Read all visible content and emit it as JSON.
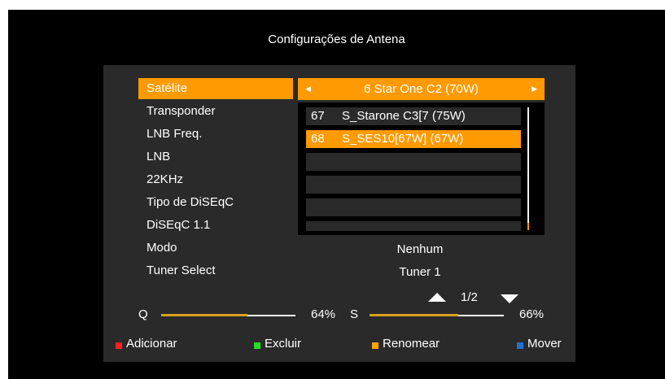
{
  "title": "Configurações de Antena",
  "menu": [
    {
      "label": "Satélite",
      "selected": true
    },
    {
      "label": "Transponder",
      "selected": false
    },
    {
      "label": "LNB Freq.",
      "selected": false
    },
    {
      "label": "LNB",
      "selected": false
    },
    {
      "label": "22KHz",
      "selected": false
    },
    {
      "label": "Tipo de DiSEqC",
      "selected": false
    },
    {
      "label": "DiSEqC 1.1",
      "selected": false
    },
    {
      "label": "Modo",
      "selected": false
    },
    {
      "label": "Tuner Select",
      "selected": false
    }
  ],
  "satellite": {
    "value": "6 Star One C2  (70W)"
  },
  "list": [
    {
      "num": "67",
      "name": "S_Starone C3[7 (75W)",
      "selected": false
    },
    {
      "num": "68",
      "name": "S_SES10[67W] (67W)",
      "selected": true
    }
  ],
  "modo": {
    "value": "Nenhum"
  },
  "tuner": {
    "value": "Tuner 1"
  },
  "pagination": {
    "text": "1/2"
  },
  "signal": {
    "q_label": "Q",
    "q_percent": "64%",
    "q_level": 0.64,
    "s_label": "S",
    "s_percent": "66%",
    "s_level": 0.66
  },
  "legend": [
    {
      "label": "Adicionar",
      "color": "#ff2020"
    },
    {
      "label": "Excluir",
      "color": "#20e020"
    },
    {
      "label": "Renomear",
      "color": "#ffa500"
    },
    {
      "label": "Mover",
      "color": "#2070d0"
    }
  ],
  "colors": {
    "accent": "#ff9a00",
    "panel": "#2a2a2a",
    "bar": "#d9a020"
  }
}
